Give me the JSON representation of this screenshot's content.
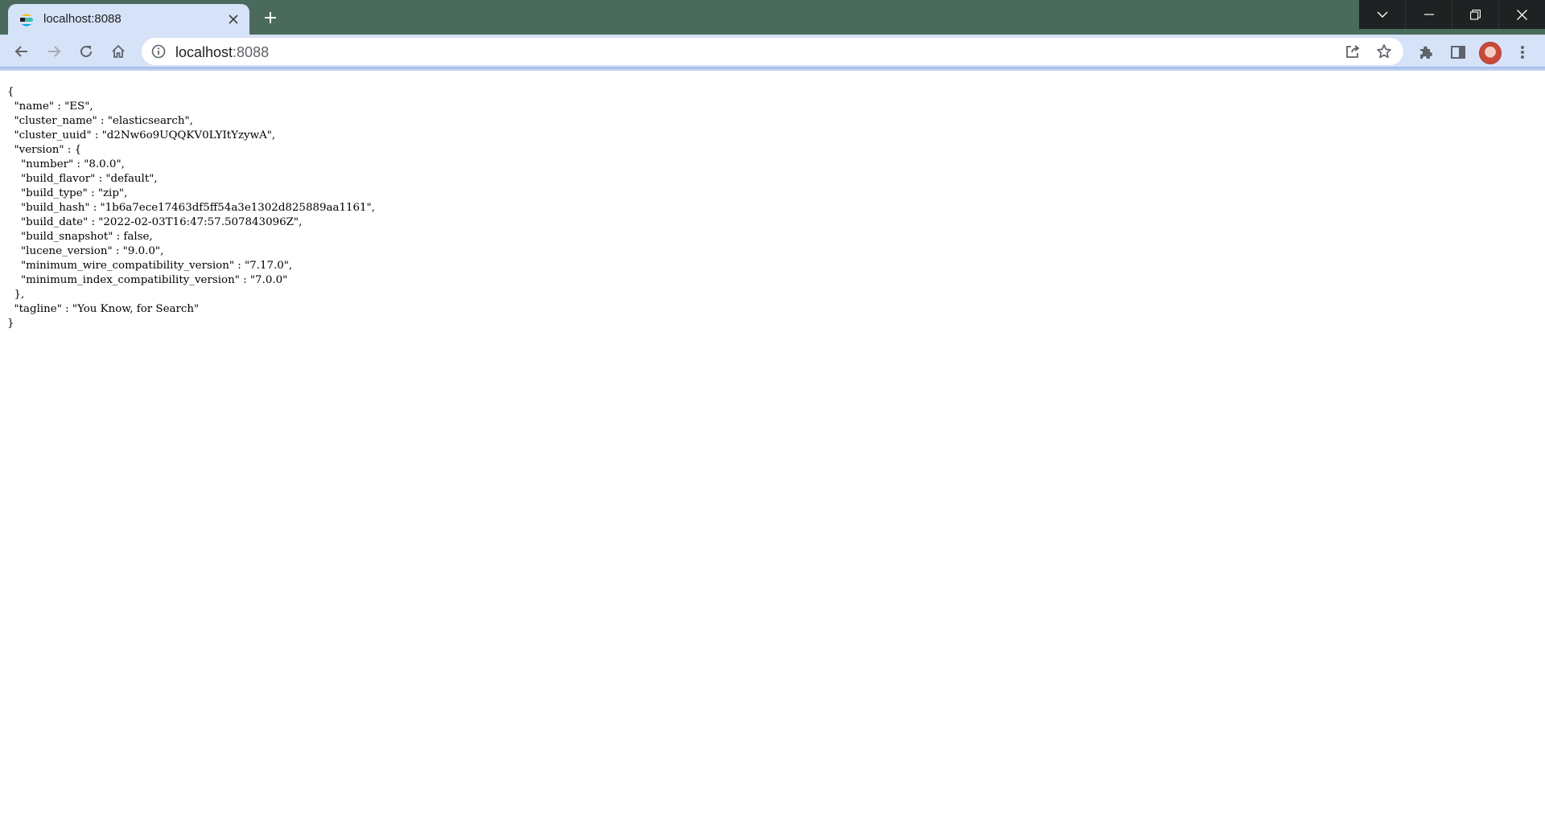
{
  "browser": {
    "tab": {
      "title": "localhost:8088",
      "favicon": "elasticsearch-logo-icon",
      "close_icon": "close-icon"
    },
    "new_tab_icon": "plus-icon",
    "window_controls": [
      "tab-search-chevron-icon",
      "minimize-icon",
      "restore-icon",
      "close-icon"
    ],
    "nav": {
      "back_icon": "arrow-left-icon",
      "forward_icon": "arrow-right-icon",
      "reload_icon": "reload-icon",
      "home_icon": "home-icon"
    },
    "omnibox": {
      "host": "localhost",
      "port": ":8088",
      "info_icon": "info-icon",
      "share_icon": "share-icon",
      "bookmark_icon": "star-icon"
    },
    "toolbar_icons": [
      "puzzle-icon",
      "side-panel-icon",
      "avatar",
      "kebab-menu-icon"
    ],
    "colors": {
      "titlebar": "#4a6b5c",
      "toolbar": "#d6e2f7",
      "window_controls": "#1e2222"
    }
  },
  "page": {
    "json_lines": [
      "{",
      "  \"name\" : \"ES\",",
      "  \"cluster_name\" : \"elasticsearch\",",
      "  \"cluster_uuid\" : \"d2Nw6o9UQQKV0LYItYzywA\",",
      "  \"version\" : {",
      "    \"number\" : \"8.0.0\",",
      "    \"build_flavor\" : \"default\",",
      "    \"build_type\" : \"zip\",",
      "    \"build_hash\" : \"1b6a7ece17463df5ff54a3e1302d825889aa1161\",",
      "    \"build_date\" : \"2022-02-03T16:47:57.507843096Z\",",
      "    \"build_snapshot\" : false,",
      "    \"lucene_version\" : \"9.0.0\",",
      "    \"minimum_wire_compatibility_version\" : \"7.17.0\",",
      "    \"minimum_index_compatibility_version\" : \"7.0.0\"",
      "  },",
      "  \"tagline\" : \"You Know, for Search\"",
      "}"
    ]
  }
}
